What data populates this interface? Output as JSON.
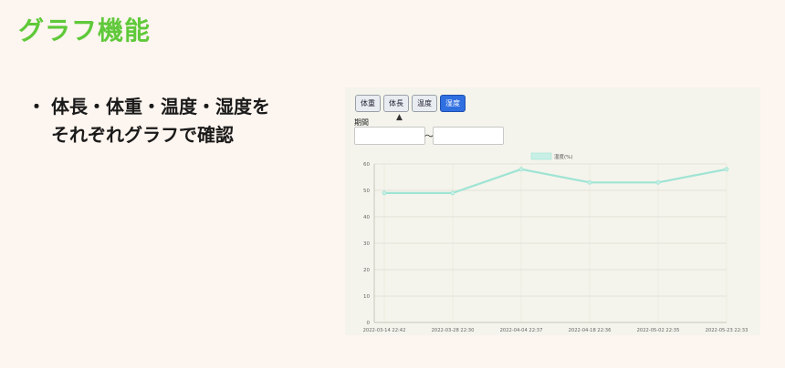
{
  "slide": {
    "title": "グラフ機能",
    "bullet_symbol": "・",
    "bullet_line1": "体長・体重・温度・湿度を",
    "bullet_line2": "それぞれグラフで確認"
  },
  "app": {
    "tabs": [
      {
        "label": "体重",
        "active": false
      },
      {
        "label": "体長",
        "active": false
      },
      {
        "label": "温度",
        "active": false
      },
      {
        "label": "湿度",
        "active": true
      }
    ],
    "period_label": "期間",
    "period_separator": "～",
    "date_from": "",
    "date_to": ""
  },
  "colors": {
    "accent_title": "#5fc93a",
    "tab_active": "#2f6fe0",
    "series_line": "#9fe4d4"
  },
  "chart_data": {
    "type": "line",
    "title": "",
    "xlabel": "",
    "ylabel": "",
    "legend": "top",
    "grid": true,
    "ylim": [
      0,
      60
    ],
    "yticks": [
      0,
      10,
      20,
      30,
      40,
      50,
      60
    ],
    "x_tick_labels": [
      "2022-03-14 22:42",
      "2022-03-28 22:30",
      "2022-04-04 22:37",
      "2022-04-18 22:36",
      "2022-05-02 22:35",
      "2022-05-23 22:33"
    ],
    "series": [
      {
        "name": "湿度(%)",
        "x": [
          "2022-03-14 22:42",
          "2022-03-28 22:30",
          "2022-04-04 22:37",
          "2022-04-18 22:36",
          "2022-05-02 22:35",
          "2022-05-23 22:33"
        ],
        "values": [
          49,
          49,
          58,
          53,
          53,
          58
        ]
      }
    ]
  }
}
